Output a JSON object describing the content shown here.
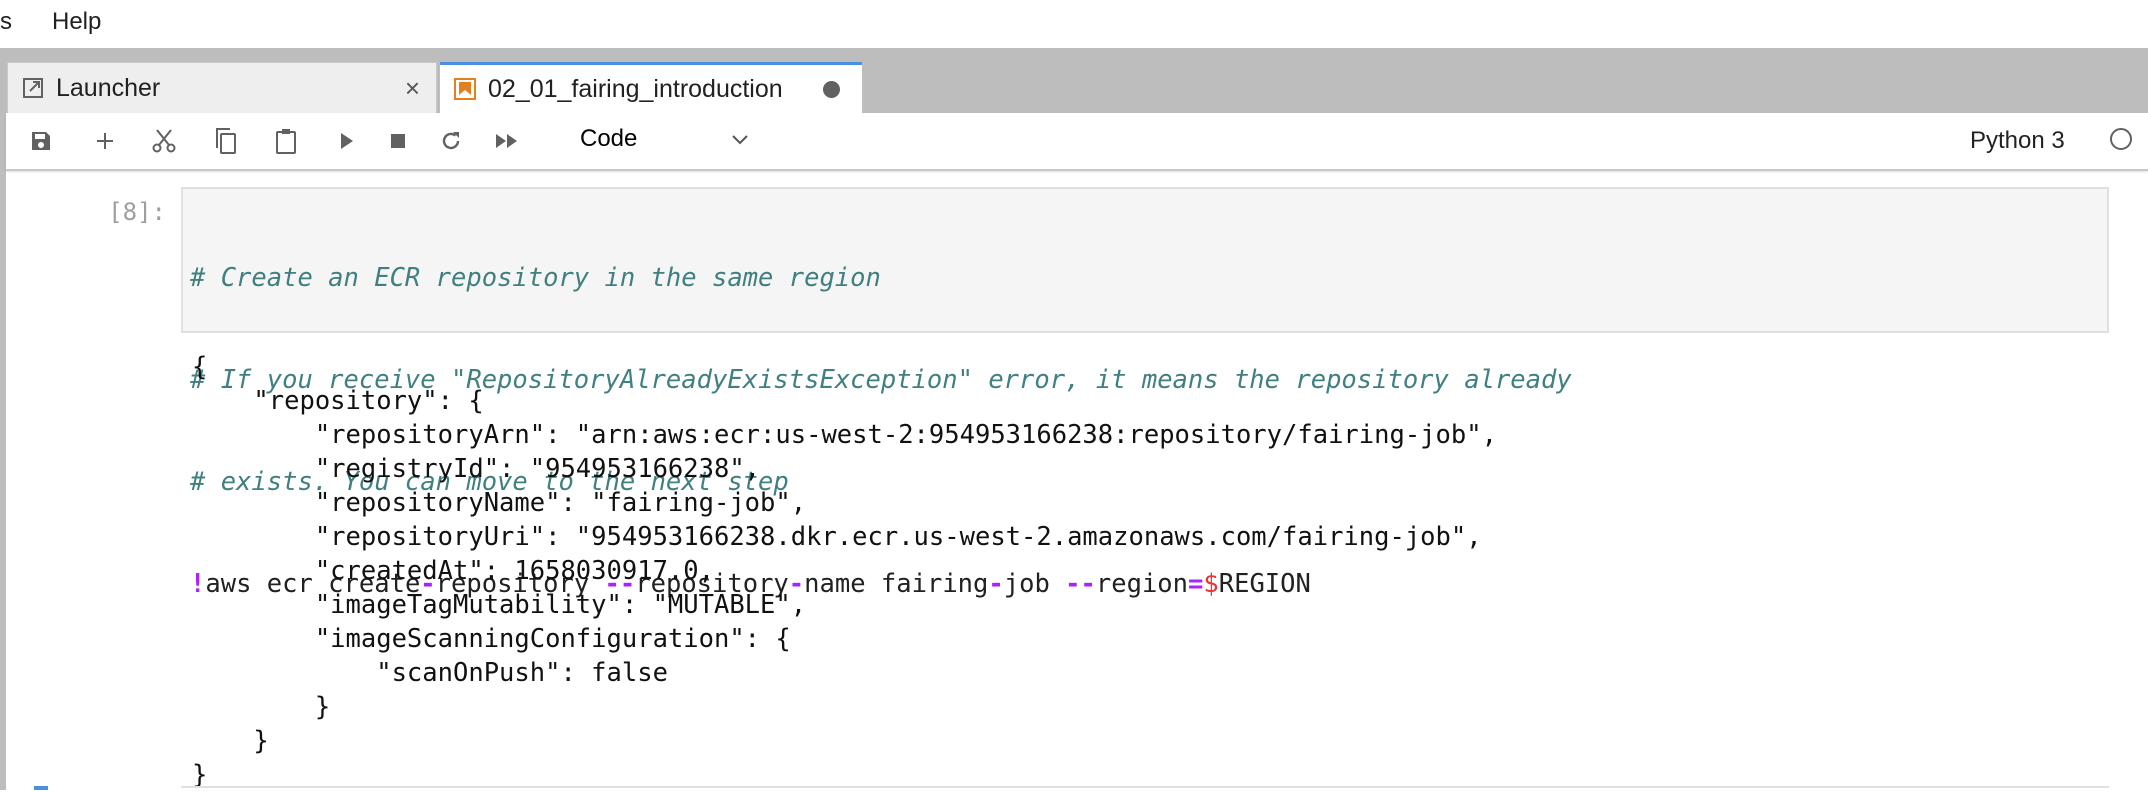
{
  "menu": [
    "s",
    "Help"
  ],
  "tabs": [
    {
      "label": "Launcher",
      "icon": "launcher-icon",
      "close": "×"
    },
    {
      "label": "02_01_fairing_introduction",
      "icon": "notebook-icon",
      "dirty": true
    }
  ],
  "toolbar": {
    "cell_type": "Code",
    "kernel": "Python 3"
  },
  "colors": {
    "accent": "#4a90e2",
    "notebook_icon": "#e67e22",
    "comment": "#408080",
    "operator": "#aa22ff",
    "variable": "#ee3333"
  },
  "cell": {
    "prompt": "[8]:",
    "comments": [
      "# Create an ECR repository in the same region",
      "# If you receive \"RepositoryAlreadyExistsException\" error, it means the repository already",
      "# exists. You can move to the next step"
    ],
    "command_tokens": [
      {
        "t": "!",
        "c": "op"
      },
      {
        "t": "aws ecr create",
        "c": ""
      },
      {
        "t": "-",
        "c": "op"
      },
      {
        "t": "repository ",
        "c": ""
      },
      {
        "t": "--",
        "c": "op"
      },
      {
        "t": "repository",
        "c": ""
      },
      {
        "t": "-",
        "c": "op"
      },
      {
        "t": "name fairing",
        "c": ""
      },
      {
        "t": "-",
        "c": "op"
      },
      {
        "t": "job ",
        "c": ""
      },
      {
        "t": "--",
        "c": "op"
      },
      {
        "t": "region",
        "c": ""
      },
      {
        "t": "=",
        "c": "op"
      },
      {
        "t": "$",
        "c": "var"
      },
      {
        "t": "REGION",
        "c": ""
      }
    ],
    "output": [
      "{",
      "    \"repository\": {",
      "        \"repositoryArn\": \"arn:aws:ecr:us-west-2:954953166238:repository/fairing-job\",",
      "        \"registryId\": \"954953166238\",",
      "        \"repositoryName\": \"fairing-job\",",
      "        \"repositoryUri\": \"954953166238.dkr.ecr.us-west-2.amazonaws.com/fairing-job\",",
      "        \"createdAt\": 1658030917.0,",
      "        \"imageTagMutability\": \"MUTABLE\",",
      "        \"imageScanningConfiguration\": {",
      "            \"scanOnPush\": false",
      "        }",
      "    }",
      "}"
    ]
  }
}
